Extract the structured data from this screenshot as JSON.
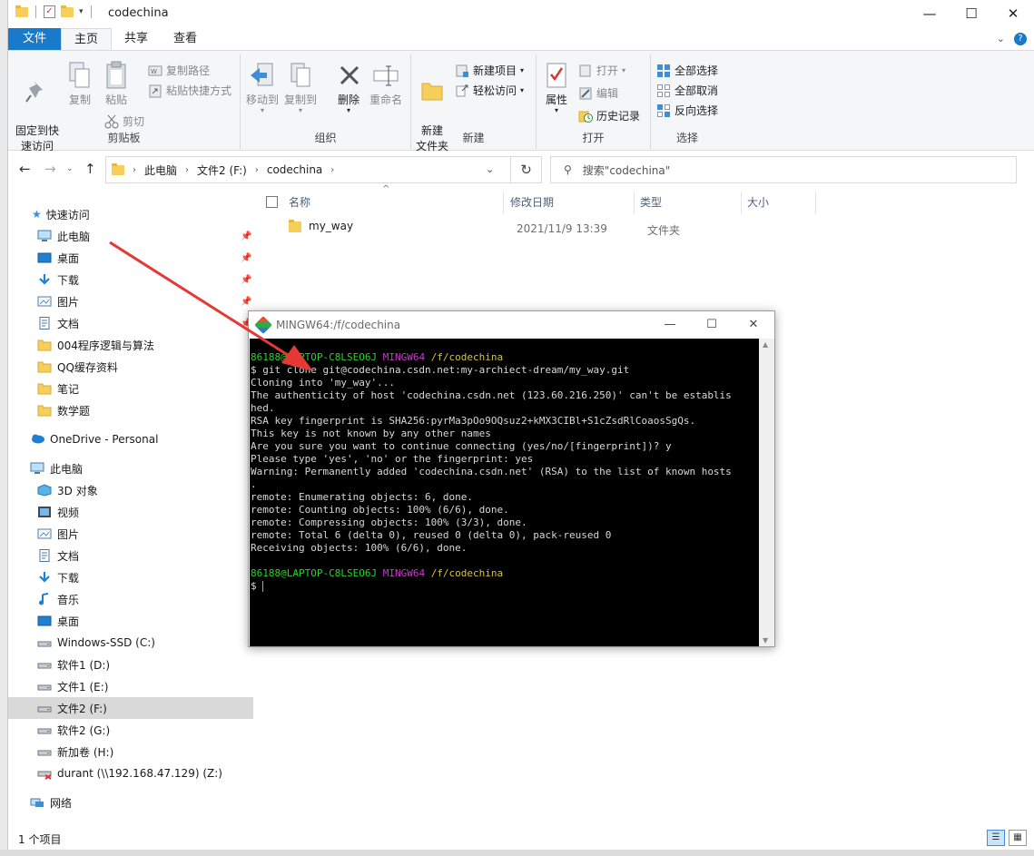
{
  "window": {
    "title": "codechina",
    "controls": {
      "minimize": "—",
      "maximize": "☐",
      "close": "✕"
    }
  },
  "ribbon_tabs": [
    {
      "label": "文件"
    },
    {
      "label": "主页"
    },
    {
      "label": "共享"
    },
    {
      "label": "查看"
    }
  ],
  "ribbon": {
    "clipboard": {
      "label": "剪贴板",
      "pin_quick_access": "固定到快\n速访问",
      "copy": "复制",
      "paste": "粘贴",
      "copy_path": "复制路径",
      "paste_shortcut": "粘贴快捷方式",
      "cut": "剪切"
    },
    "organize": {
      "label": "组织",
      "move_to": "移动到",
      "copy_to": "复制到",
      "delete": "删除",
      "rename": "重命名"
    },
    "new": {
      "label": "新建",
      "new_folder": "新建\n文件夹",
      "new_item": "新建项目",
      "easy_access": "轻松访问"
    },
    "open": {
      "label": "打开",
      "properties": "属性",
      "open": "打开",
      "edit": "编辑",
      "history": "历史记录"
    },
    "select": {
      "label": "选择",
      "select_all": "全部选择",
      "select_none": "全部取消",
      "invert": "反向选择"
    }
  },
  "address": {
    "crumbs": [
      "此电脑",
      "文件2 (F:)",
      "codechina"
    ],
    "search_placeholder": "搜索\"codechina\""
  },
  "nav": {
    "quick_access": "快速访问",
    "quick_items": [
      "此电脑",
      "桌面",
      "下载",
      "图片",
      "文档",
      "004程序逻辑与算法",
      "QQ缓存资料",
      "笔记",
      "数学题"
    ],
    "onedrive": "OneDrive - Personal",
    "this_pc": "此电脑",
    "pc_items": [
      "3D 对象",
      "视频",
      "图片",
      "文档",
      "下载",
      "音乐",
      "桌面",
      "Windows-SSD (C:)",
      "软件1 (D:)",
      "文件1 (E:)",
      "文件2 (F:)",
      "软件2 (G:)",
      "新加卷 (H:)",
      "durant (\\\\192.168.47.129) (Z:)"
    ],
    "network": "网络"
  },
  "columns": {
    "name": "名称",
    "date": "修改日期",
    "type": "类型",
    "size": "大小"
  },
  "files": [
    {
      "name": "my_way",
      "date": "2021/11/9 13:39",
      "type": "文件夹"
    }
  ],
  "status": {
    "count": "1 个项目"
  },
  "terminal": {
    "title": "MINGW64:/f/codechina",
    "prompt_user": "86188@LAPTOP-C8LSEO6J",
    "prompt_env": "MINGW64",
    "prompt_path": "/f/codechina",
    "output": [
      "$ git clone git@codechina.csdn.net:my-archiect-dream/my_way.git",
      "Cloning into 'my_way'...",
      "The authenticity of host 'codechina.csdn.net (123.60.216.250)' can't be establis",
      "hed.",
      "RSA key fingerprint is SHA256:pyrMa3pOo9OQsuz2+kMX3CIBl+S1cZsdRlCoaosSgQs.",
      "This key is not known by any other names",
      "Are you sure you want to continue connecting (yes/no/[fingerprint])? y",
      "Please type 'yes', 'no' or the fingerprint: yes",
      "Warning: Permanently added 'codechina.csdn.net' (RSA) to the list of known hosts",
      ".",
      "remote: Enumerating objects: 6, done.",
      "remote: Counting objects: 100% (6/6), done.",
      "remote: Compressing objects: 100% (3/3), done.",
      "remote: Total 6 (delta 0), reused 0 (delta 0), pack-reused 0",
      "Receiving objects: 100% (6/6), done."
    ],
    "final_prompt": "$ "
  },
  "colors": {
    "accent": "#1979ca",
    "arrow": "#e53935",
    "term_bg": "#000000",
    "prompt_green": "#28d228",
    "prompt_magenta": "#c93ac9",
    "prompt_yellow": "#d6c43a"
  }
}
